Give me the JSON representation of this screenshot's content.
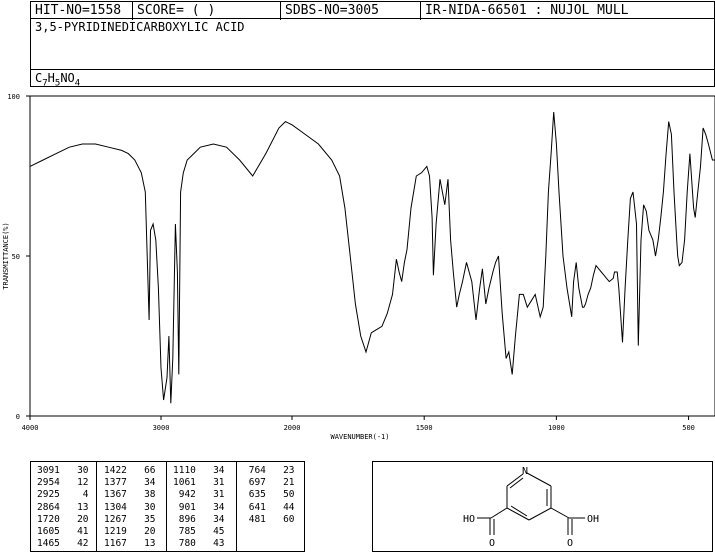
{
  "header": {
    "hit_no": "HIT-NO=1558",
    "score": "SCORE=  (   )",
    "sdbs_no": "SDBS-NO=3005",
    "ir_info": "IR-NIDA-66501 : NUJOL MULL"
  },
  "compound": {
    "name": "3,5-PYRIDINEDICARBOXYLIC ACID",
    "formula_parts": [
      "C",
      "7",
      "H",
      "5",
      "NO",
      "4"
    ]
  },
  "chart_data": {
    "type": "line",
    "title": "",
    "xlabel": "WAVENUMBER(-1)",
    "ylabel": "TRANSMITTANCE(%)",
    "xlim": [
      4000,
      400
    ],
    "ylim": [
      0,
      100
    ],
    "x_ticks": [
      4000,
      3000,
      2000,
      1500,
      1000,
      500
    ],
    "y_ticks": [
      0,
      50,
      100
    ],
    "grid": false,
    "series": [
      {
        "name": "",
        "x": [
          4000,
          3900,
          3800,
          3700,
          3600,
          3500,
          3400,
          3300,
          3250,
          3200,
          3150,
          3120,
          3091,
          3080,
          3060,
          3040,
          3020,
          3000,
          2980,
          2954,
          2940,
          2925,
          2910,
          2890,
          2875,
          2864,
          2850,
          2830,
          2800,
          2750,
          2700,
          2600,
          2500,
          2400,
          2300,
          2200,
          2100,
          2050,
          2000,
          1950,
          1900,
          1850,
          1820,
          1800,
          1780,
          1760,
          1740,
          1720,
          1700,
          1680,
          1660,
          1640,
          1620,
          1605,
          1595,
          1585,
          1575,
          1565,
          1550,
          1530,
          1510,
          1490,
          1480,
          1470,
          1465,
          1455,
          1440,
          1422,
          1410,
          1400,
          1390,
          1377,
          1367,
          1355,
          1340,
          1320,
          1304,
          1290,
          1280,
          1267,
          1255,
          1240,
          1230,
          1219,
          1205,
          1190,
          1180,
          1167,
          1155,
          1140,
          1125,
          1110,
          1095,
          1080,
          1061,
          1050,
          1040,
          1030,
          1020,
          1010,
          1000,
          990,
          975,
          960,
          942,
          935,
          925,
          915,
          901,
          896,
          890,
          880,
          870,
          860,
          850,
          840,
          830,
          820,
          810,
          800,
          785,
          780,
          770,
          764,
          750,
          740,
          730,
          720,
          710,
          697,
          690,
          680,
          670,
          660,
          650,
          635,
          625,
          615,
          605,
          595,
          585,
          575,
          565,
          555,
          545,
          541,
          535,
          525,
          515,
          505,
          495,
          481,
          475,
          465,
          455,
          445,
          435,
          425,
          410,
          400
        ],
        "y": [
          78,
          80,
          82,
          84,
          85,
          85,
          84,
          83,
          82,
          80,
          76,
          70,
          30,
          58,
          60,
          55,
          40,
          15,
          5,
          12,
          25,
          4,
          18,
          60,
          45,
          13,
          70,
          76,
          80,
          82,
          84,
          85,
          84,
          80,
          75,
          82,
          90,
          92,
          91,
          88,
          85,
          80,
          75,
          65,
          50,
          35,
          25,
          20,
          26,
          27,
          28,
          32,
          38,
          49,
          45,
          42,
          48,
          52,
          65,
          75,
          76,
          78,
          75,
          62,
          44,
          60,
          74,
          66,
          74,
          55,
          45,
          34,
          38,
          42,
          48,
          42,
          30,
          40,
          46,
          35,
          40,
          45,
          48,
          50,
          32,
          18,
          20,
          13,
          25,
          38,
          38,
          34,
          36,
          38,
          31,
          34,
          50,
          70,
          82,
          95,
          85,
          70,
          50,
          40,
          31,
          42,
          48,
          40,
          34,
          34,
          35,
          38,
          40,
          44,
          47,
          46,
          45,
          44,
          43,
          42,
          43,
          45,
          45,
          40,
          23,
          40,
          55,
          68,
          70,
          60,
          22,
          55,
          66,
          64,
          58,
          55,
          50,
          55,
          62,
          70,
          82,
          92,
          88,
          70,
          55,
          50,
          47,
          48,
          55,
          70,
          82,
          65,
          62,
          70,
          78,
          90,
          88,
          85,
          80,
          80
        ]
      }
    ]
  },
  "peak_table": [
    [
      {
        "wavenumber": "3091",
        "t": "30"
      },
      {
        "wavenumber": "2954",
        "t": "12"
      },
      {
        "wavenumber": "2925",
        "t": "4"
      },
      {
        "wavenumber": "2864",
        "t": "13"
      },
      {
        "wavenumber": "1720",
        "t": "20"
      },
      {
        "wavenumber": "1605",
        "t": "41"
      },
      {
        "wavenumber": "1465",
        "t": "42"
      }
    ],
    [
      {
        "wavenumber": "1422",
        "t": "66"
      },
      {
        "wavenumber": "1377",
        "t": "34"
      },
      {
        "wavenumber": "1367",
        "t": "38"
      },
      {
        "wavenumber": "1304",
        "t": "30"
      },
      {
        "wavenumber": "1267",
        "t": "35"
      },
      {
        "wavenumber": "1219",
        "t": "20"
      },
      {
        "wavenumber": "1167",
        "t": "13"
      }
    ],
    [
      {
        "wavenumber": "1110",
        "t": "34"
      },
      {
        "wavenumber": "1061",
        "t": "31"
      },
      {
        "wavenumber": "942",
        "t": "31"
      },
      {
        "wavenumber": "901",
        "t": "34"
      },
      {
        "wavenumber": "896",
        "t": "34"
      },
      {
        "wavenumber": "785",
        "t": "45"
      },
      {
        "wavenumber": "780",
        "t": "43"
      }
    ],
    [
      {
        "wavenumber": "764",
        "t": "23"
      },
      {
        "wavenumber": "697",
        "t": "21"
      },
      {
        "wavenumber": "635",
        "t": "50"
      },
      {
        "wavenumber": "641",
        "t": "44"
      },
      {
        "wavenumber": "481",
        "t": "60"
      }
    ]
  ],
  "structure": {
    "n_label": "N",
    "left_label": "HO",
    "right_label": "OH",
    "o_left": "O",
    "o_right": "O"
  }
}
